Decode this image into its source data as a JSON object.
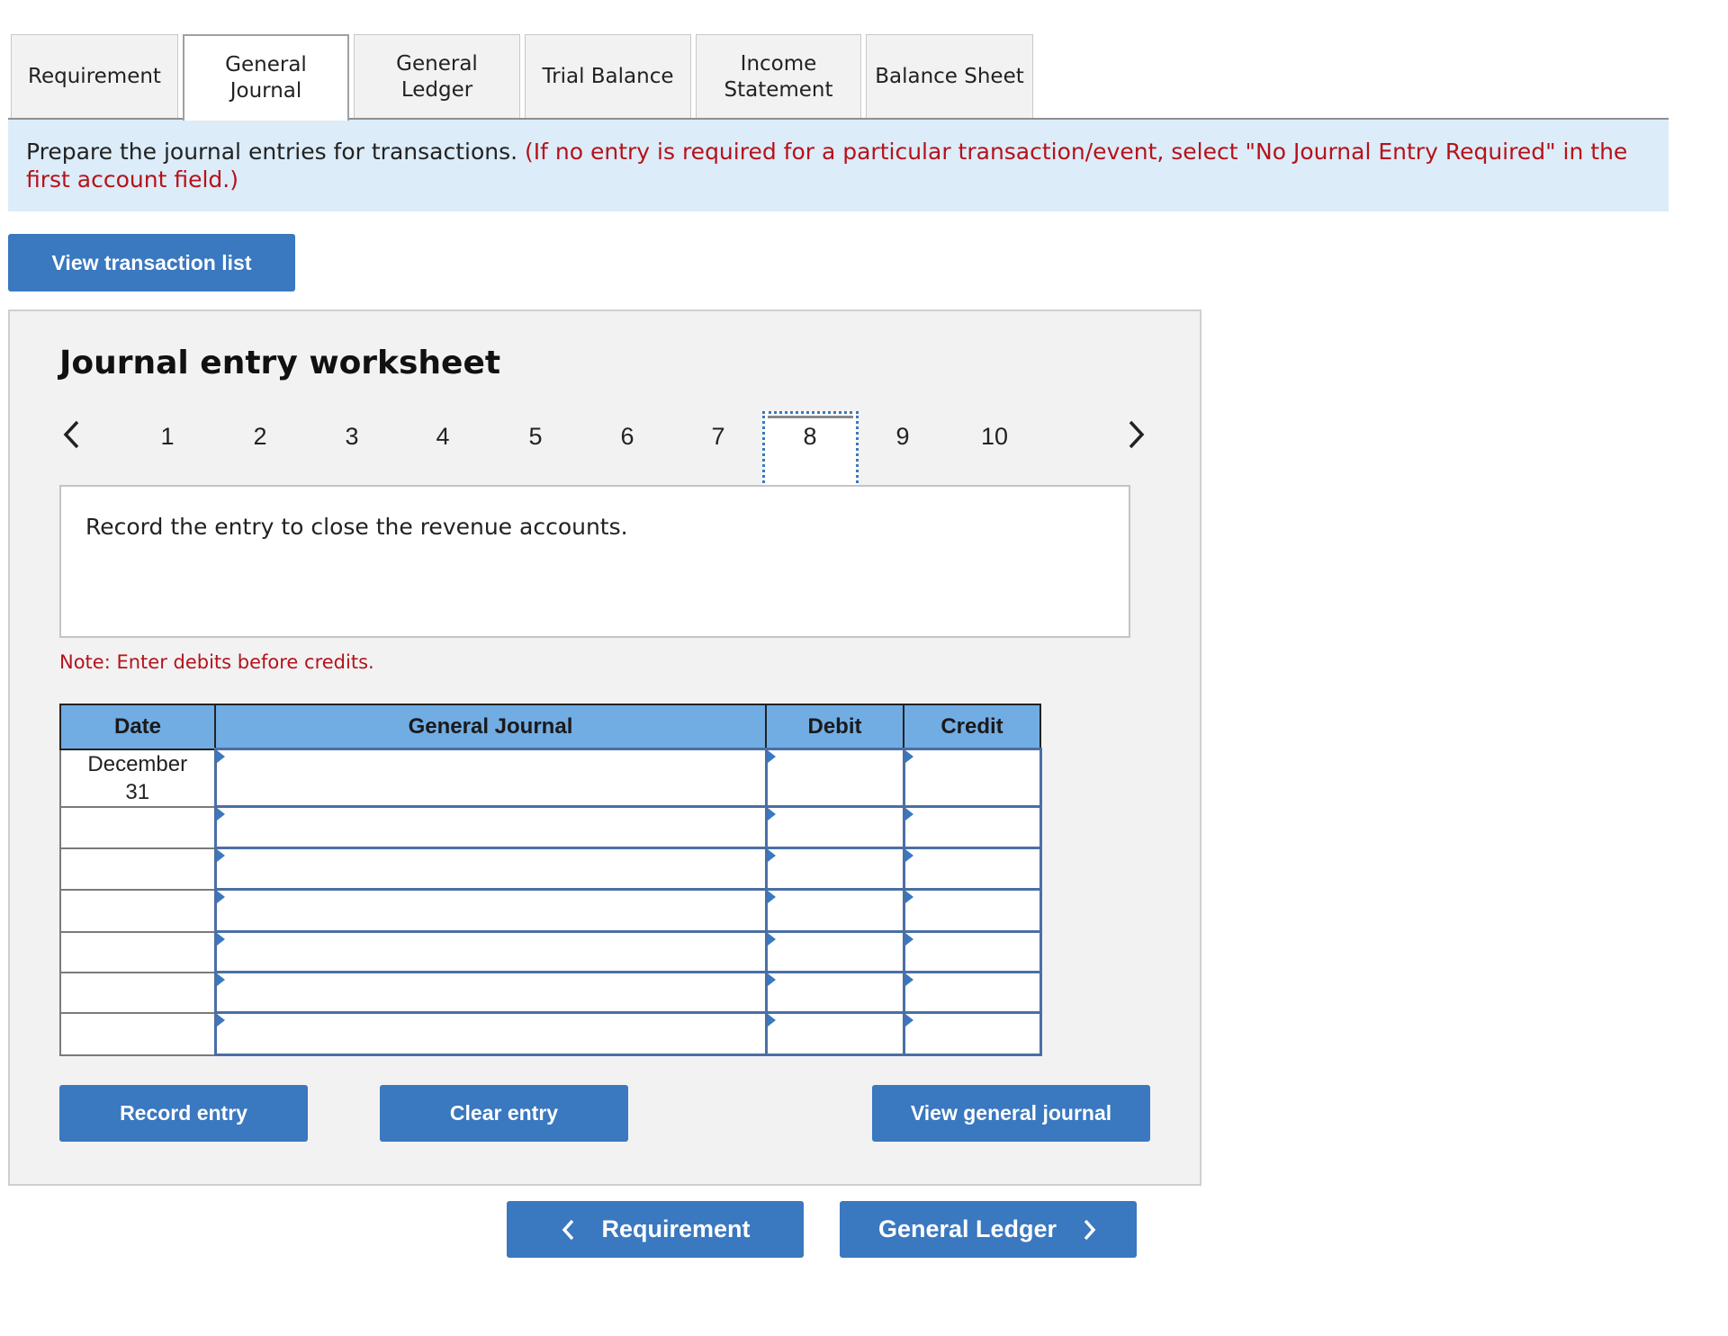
{
  "tabs": [
    {
      "label": "Requirement",
      "active": false
    },
    {
      "label": "General\nJournal",
      "active": true
    },
    {
      "label": "General\nLedger",
      "active": false
    },
    {
      "label": "Trial Balance",
      "active": false
    },
    {
      "label": "Income\nStatement",
      "active": false
    },
    {
      "label": "Balance Sheet",
      "active": false
    }
  ],
  "instructions": {
    "main": "Prepare the journal entries for transactions.",
    "note": "(If no entry is required for a particular transaction/event, select \"No Journal Entry Required\" in the first account field.)"
  },
  "view_transaction_list_label": "View transaction list",
  "worksheet": {
    "title": "Journal entry worksheet",
    "pages": [
      "1",
      "2",
      "3",
      "4",
      "5",
      "6",
      "7",
      "8",
      "9",
      "10"
    ],
    "current_page": "8",
    "prev_icon": "chevron-left",
    "next_icon": "chevron-right",
    "description": "Record the entry to close the revenue accounts.",
    "note": "Note: Enter debits before credits.",
    "table": {
      "headers": {
        "date": "Date",
        "account": "General Journal",
        "debit": "Debit",
        "credit": "Credit"
      },
      "rows": [
        {
          "date": "December\n31",
          "account": "",
          "debit": "",
          "credit": ""
        },
        {
          "date": "",
          "account": "",
          "debit": "",
          "credit": ""
        },
        {
          "date": "",
          "account": "",
          "debit": "",
          "credit": ""
        },
        {
          "date": "",
          "account": "",
          "debit": "",
          "credit": ""
        },
        {
          "date": "",
          "account": "",
          "debit": "",
          "credit": ""
        },
        {
          "date": "",
          "account": "",
          "debit": "",
          "credit": ""
        },
        {
          "date": "",
          "account": "",
          "debit": "",
          "credit": ""
        }
      ]
    },
    "buttons": {
      "record": "Record entry",
      "clear": "Clear entry",
      "view_journal": "View general journal"
    }
  },
  "nav": {
    "prev_label": "Requirement",
    "next_label": "General Ledger"
  },
  "colors": {
    "accent": "#3a78bf",
    "header": "#71ace3",
    "band": "#dcecf8",
    "warning": "#b5121b"
  }
}
